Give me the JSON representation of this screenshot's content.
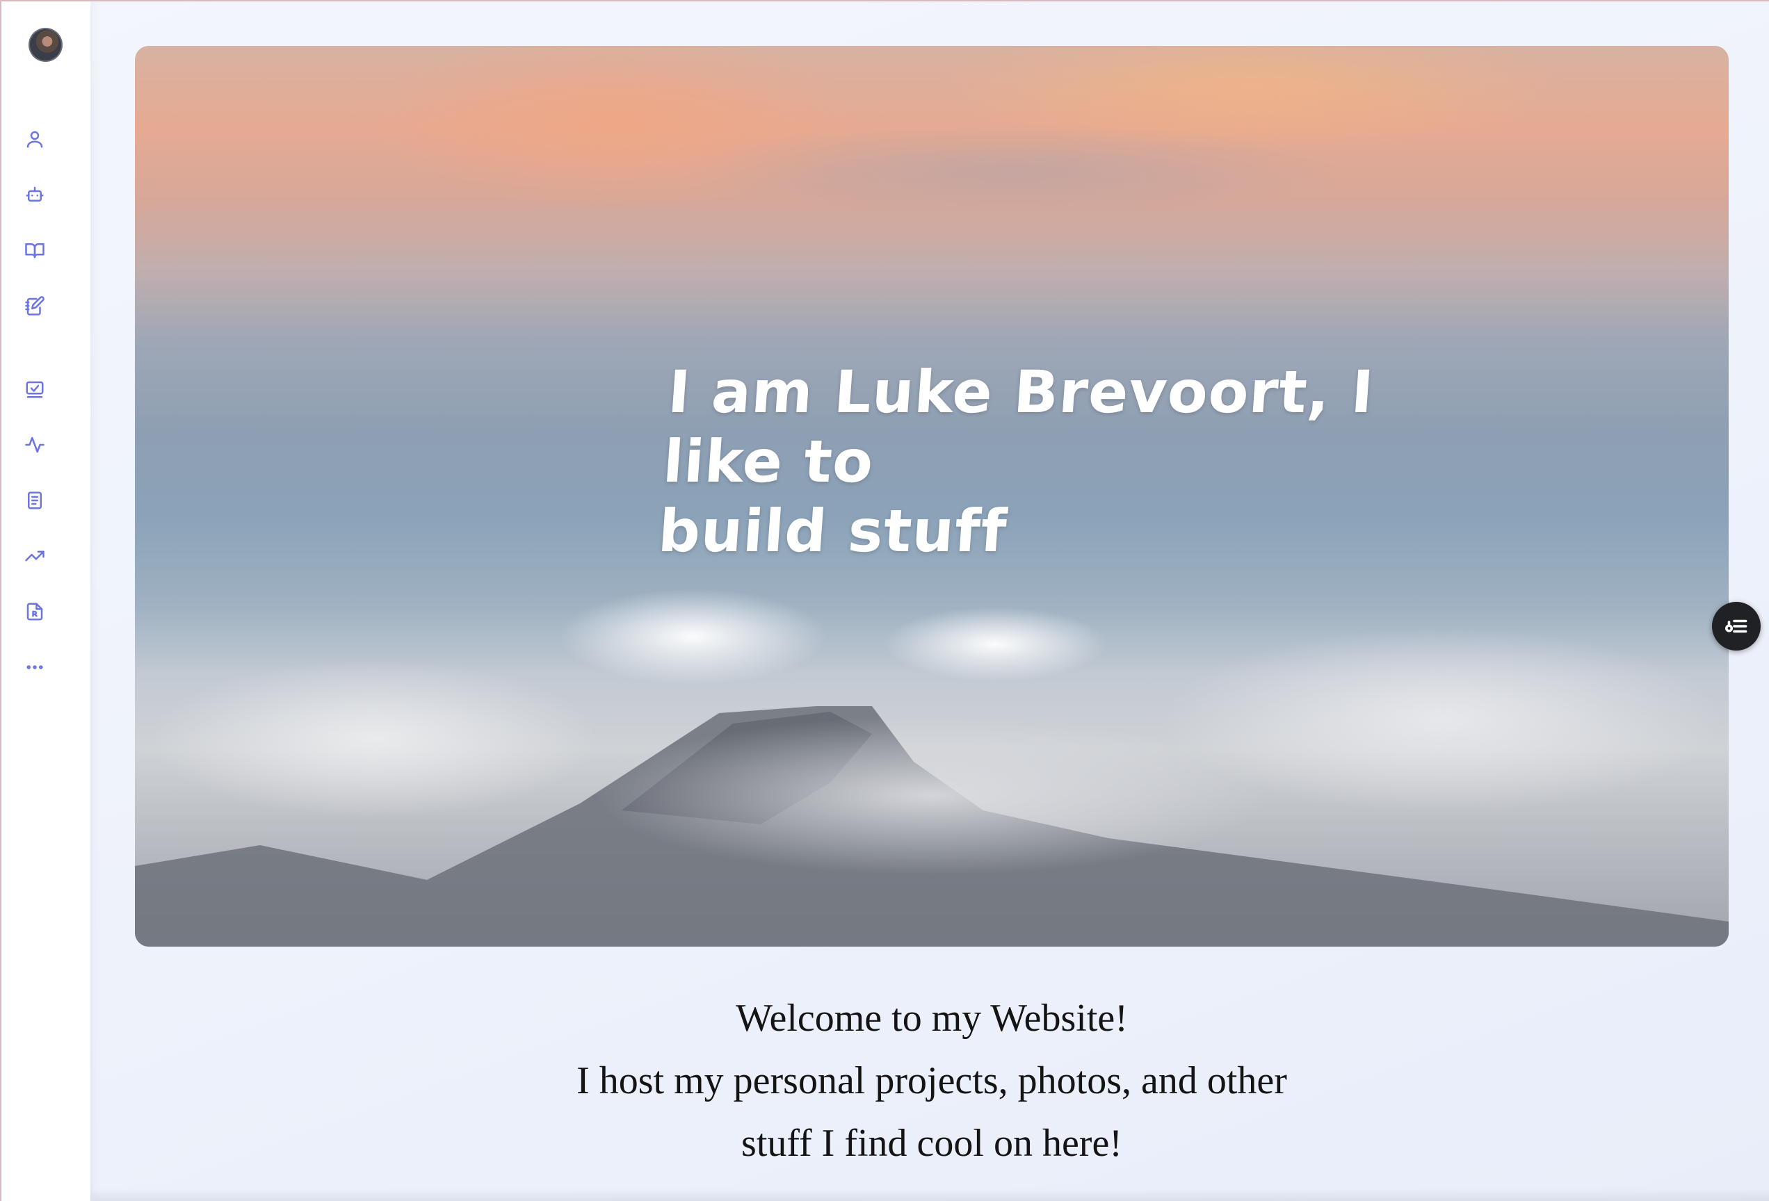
{
  "sidebar": {
    "avatar_alt": "profile avatar",
    "items": [
      {
        "icon": "user-icon"
      },
      {
        "icon": "robot-icon"
      },
      {
        "icon": "book-open-icon"
      },
      {
        "icon": "notebook-edit-icon"
      },
      {
        "icon": "checklist-icon"
      },
      {
        "icon": "activity-icon"
      },
      {
        "icon": "document-icon"
      },
      {
        "icon": "trending-up-icon"
      },
      {
        "icon": "resume-icon"
      },
      {
        "icon": "more-icon"
      }
    ],
    "accent_color": "#6b74e0"
  },
  "hero": {
    "headline_line1": "I am Luke Brevoort, I like to",
    "headline_line2": "build stuff"
  },
  "welcome": {
    "line1": "Welcome to my Website!",
    "line2": "I host my personal projects, photos, and other",
    "line3": "stuff I find cool on here!"
  },
  "floating": {
    "toc_icon": "table-of-contents-icon"
  }
}
